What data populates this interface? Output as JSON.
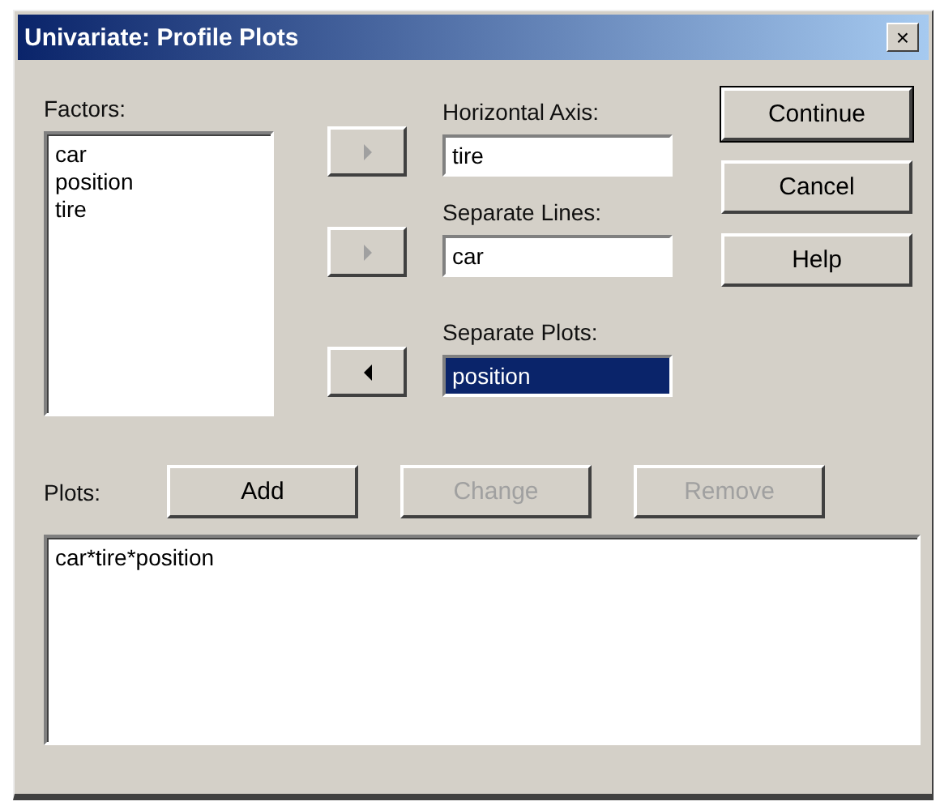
{
  "window": {
    "title": "Univariate: Profile Plots",
    "close": "×"
  },
  "factors": {
    "label": "Factors:",
    "items": [
      "car",
      "position",
      "tire"
    ]
  },
  "targets": [
    {
      "label": "Horizontal Axis:",
      "value": "tire",
      "selected": false,
      "arrow": {
        "kind": "right",
        "disabled": true
      }
    },
    {
      "label": "Separate Lines:",
      "value": "car",
      "selected": false,
      "arrow": {
        "kind": "right",
        "disabled": true
      }
    },
    {
      "label": "Separate Plots:",
      "value": "position",
      "selected": true,
      "arrow": {
        "kind": "left",
        "disabled": false
      }
    }
  ],
  "buttons": [
    {
      "label": "Continue",
      "default": true
    },
    {
      "label": "Cancel",
      "default": false
    },
    {
      "label": "Help",
      "default": false
    }
  ],
  "plots": {
    "label": "Plots:",
    "buttons": [
      {
        "label": "Add",
        "disabled": false
      },
      {
        "label": "Change",
        "disabled": true
      },
      {
        "label": "Remove",
        "disabled": true
      }
    ],
    "items": [
      "car*tire*position"
    ]
  }
}
